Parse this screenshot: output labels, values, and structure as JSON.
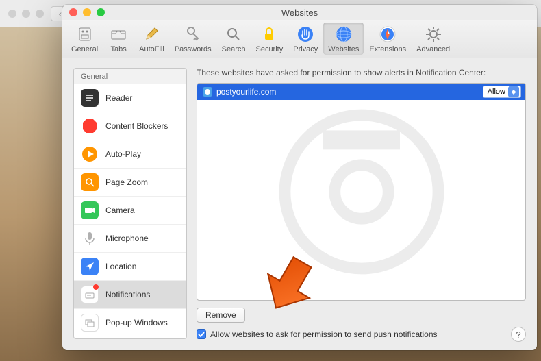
{
  "window": {
    "title": "Websites"
  },
  "toolbar": {
    "items": [
      {
        "label": "General",
        "id": "general"
      },
      {
        "label": "Tabs",
        "id": "tabs"
      },
      {
        "label": "AutoFill",
        "id": "autofill"
      },
      {
        "label": "Passwords",
        "id": "passwords"
      },
      {
        "label": "Search",
        "id": "search"
      },
      {
        "label": "Security",
        "id": "security"
      },
      {
        "label": "Privacy",
        "id": "privacy"
      },
      {
        "label": "Websites",
        "id": "websites"
      },
      {
        "label": "Extensions",
        "id": "extensions"
      },
      {
        "label": "Advanced",
        "id": "advanced"
      }
    ],
    "selected": "Websites"
  },
  "sidebar": {
    "header": "General",
    "items": [
      {
        "label": "Reader",
        "icon": "reader-icon",
        "color": "#333333"
      },
      {
        "label": "Content Blockers",
        "icon": "octagon-icon",
        "color": "#ff3b30"
      },
      {
        "label": "Auto-Play",
        "icon": "play-icon",
        "color": "#ff9500"
      },
      {
        "label": "Page Zoom",
        "icon": "zoom-icon",
        "color": "#ff9500"
      },
      {
        "label": "Camera",
        "icon": "camera-icon",
        "color": "#34c759"
      },
      {
        "label": "Microphone",
        "icon": "microphone-icon",
        "color": "#b0b0b0"
      },
      {
        "label": "Location",
        "icon": "location-icon",
        "color": "#3b82f6"
      },
      {
        "label": "Notifications",
        "icon": "notification-icon",
        "color": "#ffffff",
        "selected": true,
        "badge": true
      },
      {
        "label": "Pop-up Windows",
        "icon": "popup-icon",
        "color": "#ffffff"
      }
    ]
  },
  "panel": {
    "heading": "These websites have asked for permission to show alerts in Notification Center:",
    "sites": [
      {
        "domain": "postyourlife.com",
        "permission": "Allow"
      }
    ],
    "remove_label": "Remove",
    "checkbox_label": "Allow websites to ask for permission to send push notifications",
    "checkbox_checked": true
  },
  "help": {
    "label": "?"
  }
}
